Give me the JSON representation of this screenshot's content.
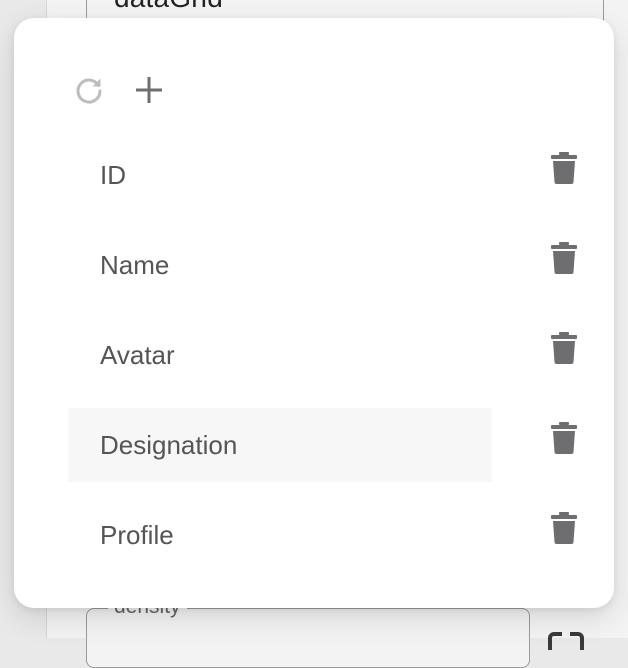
{
  "background": {
    "top_field_value": "dataGrid",
    "bottom_field_label": "density"
  },
  "toolbar": {
    "refresh_icon": "refresh-icon",
    "add_icon": "plus-icon"
  },
  "columns": [
    {
      "label": "ID",
      "delete_icon": "trash-icon"
    },
    {
      "label": "Name",
      "delete_icon": "trash-icon"
    },
    {
      "label": "Avatar",
      "delete_icon": "trash-icon"
    },
    {
      "label": "Designation",
      "delete_icon": "trash-icon"
    },
    {
      "label": "Profile",
      "delete_icon": "trash-icon"
    }
  ],
  "colors": {
    "label_text": "#555557",
    "icon": "#6e6e70",
    "refresh_icon_disabled": "#bdbdbd",
    "hover_row_bg": "#f7f7f7"
  }
}
